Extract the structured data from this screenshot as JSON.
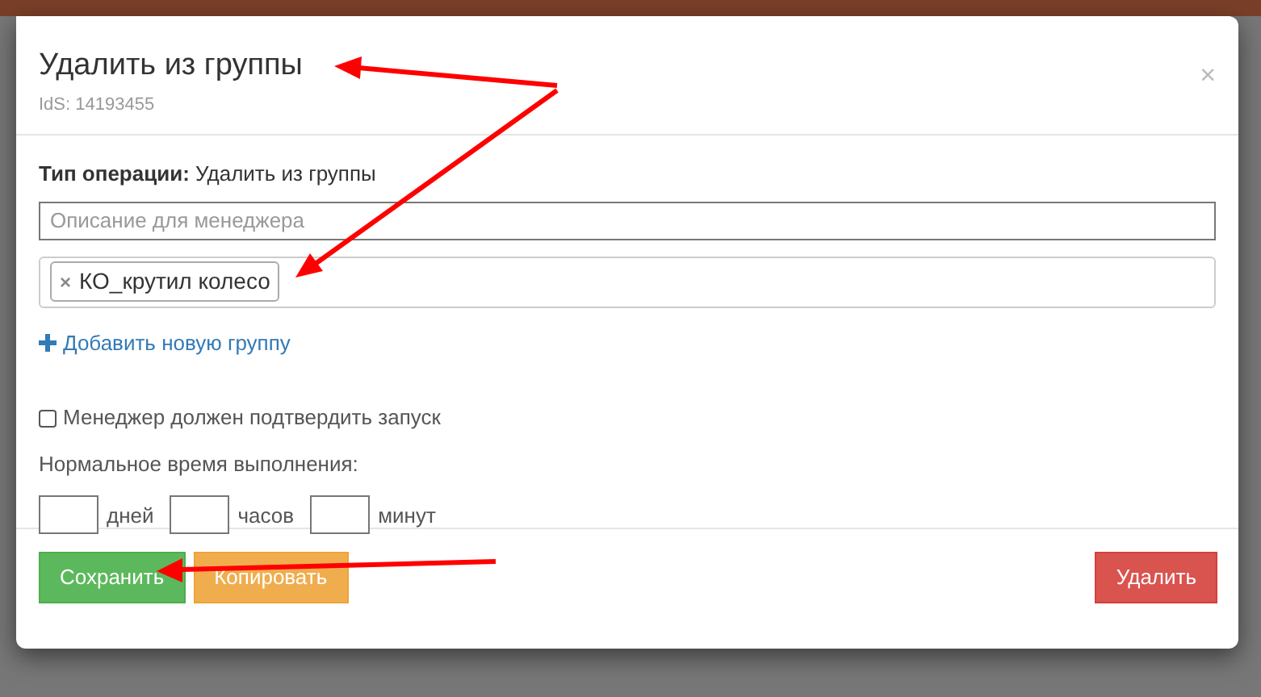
{
  "dialog": {
    "title": "Удалить из группы",
    "subtitle": "IdS: 14193455",
    "close": "×"
  },
  "operation": {
    "text": "**Тип операции:** Удалить из группы"
  },
  "description": {
    "placeholder": "Описание для менеджера"
  },
  "groups": [
    {
      "label": "КО_крутил колесо",
      "remove": "×"
    }
  ],
  "add_group": {
    "label": "Добавить новую группу"
  },
  "confirm": {
    "label": "Менеджер должен подтвердить запуск",
    "checked": false
  },
  "duration": {
    "label": "Нормальное время выполнения:",
    "fields": [
      {
        "unit": "дней"
      },
      {
        "unit": "часов"
      },
      {
        "unit": "минут"
      }
    ]
  },
  "buttons": [
    {
      "label": "Сохранить",
      "kind": "success"
    },
    {
      "label": "Копировать",
      "kind": "warning"
    },
    {
      "label": "Удалить",
      "kind": "danger"
    }
  ]
}
